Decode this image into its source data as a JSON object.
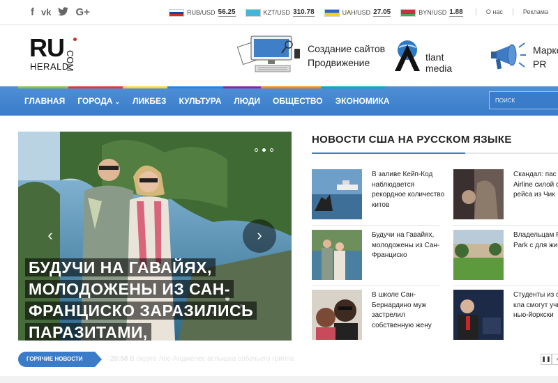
{
  "social": [
    {
      "name": "facebook-icon",
      "glyph": "f"
    },
    {
      "name": "vk-icon",
      "glyph": "vk"
    },
    {
      "name": "twitter-icon",
      "glyph": "ὂ6"
    },
    {
      "name": "google-plus-icon",
      "glyph": "G+"
    }
  ],
  "rates": [
    {
      "pair": "RUB/USD",
      "value": "56.25"
    },
    {
      "pair": "KZT/USD",
      "value": "310.78"
    },
    {
      "pair": "UAH/USD",
      "value": "27.05"
    },
    {
      "pair": "BYN/USD",
      "value": "1.88"
    }
  ],
  "toplinks": {
    "about": "О нас",
    "ads": "Реклама"
  },
  "logo": {
    "main": "RU",
    "sub": "HERALD",
    "suffix": "COM"
  },
  "ads": {
    "ad1_line1": "Создание сайтов",
    "ad1_line2": "Продвижение",
    "ad2_line1": "tlant",
    "ad2_line2": "media",
    "ad3_line1": "Марке",
    "ad3_line2": "PR"
  },
  "nav": {
    "items": [
      "ГЛАВНАЯ",
      "ГОРОДА",
      "ЛИКБЕЗ",
      "КУЛЬТУРА",
      "ЛЮДИ",
      "ОБЩЕСТВО",
      "ЭКОНОМИКА"
    ],
    "caret": "⌄",
    "search_placeholder": "ПОИСК",
    "colors": [
      "#8bc34a",
      "#e53935",
      "#fdd835",
      "#1e88e5",
      "#8e24aa",
      "#fb8c00",
      "#00acc1",
      "#d81b60"
    ]
  },
  "slider": {
    "title": "БУДУЧИ НА ГАВАЙЯХ, МОЛОДОЖЕНЫ ИЗ САН-ФРАНЦИСКО ЗАРАЗИЛИСЬ ПАРАЗИТАМИ,",
    "prev": "‹",
    "next": "›"
  },
  "news": {
    "heading": "НОВОСТИ США НА РУССКОМ ЯЗЫКЕ",
    "items": [
      {
        "text": "В заливе Кейп-Код наблюдается рекордное количество китов"
      },
      {
        "text": "Скандал: пас United Airline силой сняли рейса из Чик"
      },
      {
        "text": "Будучи на Гавайях, молодожены из Сан-Франциско"
      },
      {
        "text": "Владельцам Precita Park с для животны"
      },
      {
        "text": "В школе Сан-Бернардино муж застрелил собственную жену"
      },
      {
        "text": "Студенты из среднего кла смогут учиться нью-йоркски"
      }
    ]
  },
  "ticker": {
    "label": "ГОРЯЧИЕ НОВОСТИ",
    "time": "20:58",
    "text": "В округе Лос-Анджелес вспышка собачьего гриппа",
    "pause": "❚❚",
    "next": "›"
  },
  "colors": {
    "accent": "#3a7cc9"
  }
}
